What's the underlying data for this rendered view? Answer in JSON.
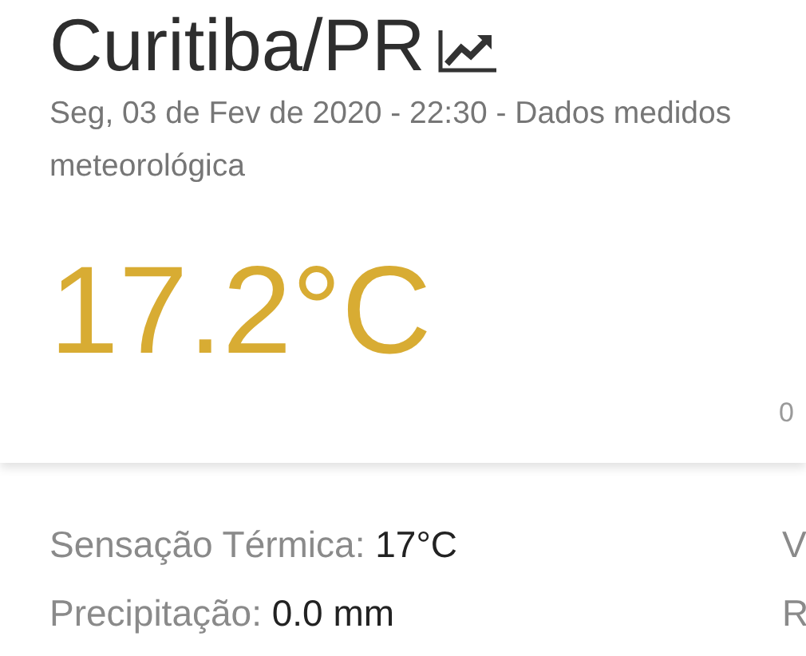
{
  "header": {
    "city": "Curitiba/PR",
    "subtitle_lines": [
      "Seg, 03 de Fev de 2020 - 22:30 - Dados medidos",
      "meteorológica"
    ]
  },
  "current": {
    "temperature": "17.2°C",
    "column_2": "0"
  },
  "details": [
    {
      "label": "Sensação Térmica:",
      "value": "17°C"
    },
    {
      "label": "Precipitação:",
      "value": "0.0 mm"
    }
  ],
  "details_column_2": [
    "V",
    "R"
  ]
}
